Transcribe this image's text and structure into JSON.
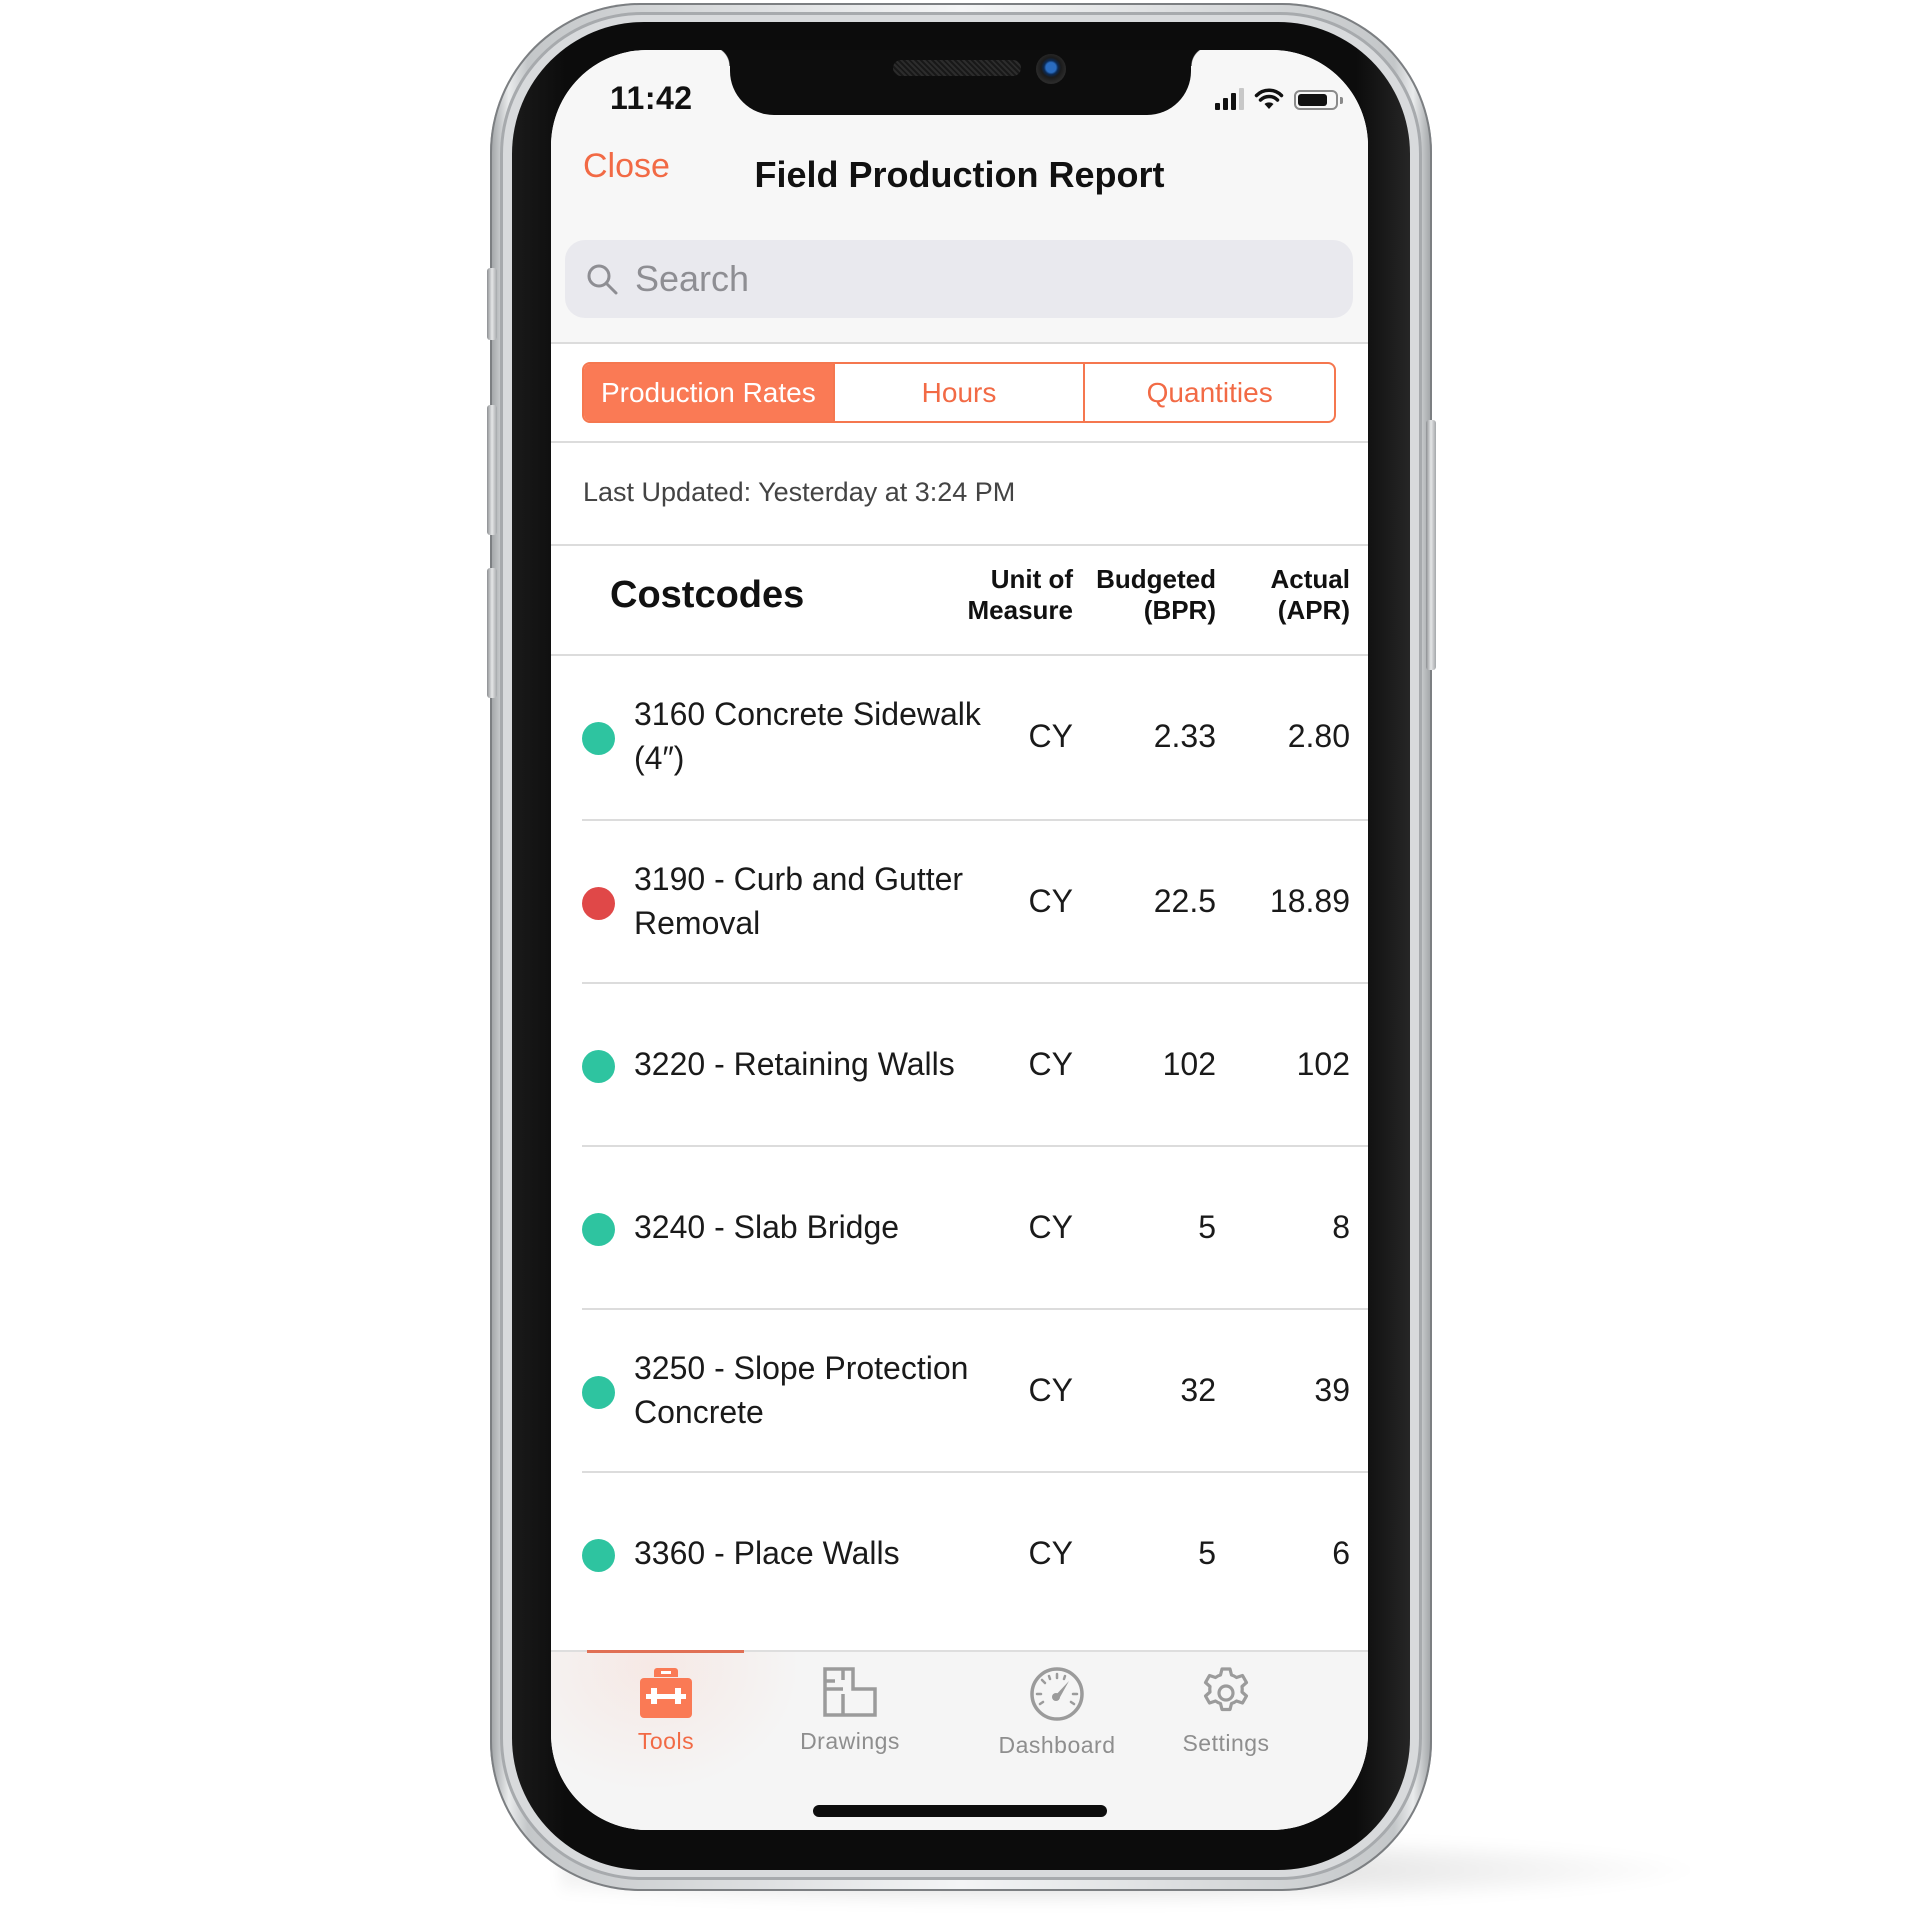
{
  "status_bar": {
    "time": "11:42",
    "signal_bars_filled": 3,
    "signal_bars_total": 4,
    "battery_level": 0.8
  },
  "nav": {
    "close_label": "Close",
    "title": "Field Production Report"
  },
  "search": {
    "placeholder": "Search",
    "value": ""
  },
  "segments": [
    {
      "label": "Production Rates",
      "active": true
    },
    {
      "label": "Hours",
      "active": false
    },
    {
      "label": "Quantities",
      "active": false
    }
  ],
  "last_updated": "Last Updated: Yesterday at 3:24 PM",
  "table": {
    "title": "Costcodes",
    "columns": {
      "unit_line1": "Unit of",
      "unit_line2": "Measure",
      "budgeted_line1": "Budgeted",
      "budgeted_line2": "(BPR)",
      "actual_line1": "Actual",
      "actual_line2": "(APR)"
    },
    "rows": [
      {
        "name": "3160 Concrete Sidewalk (4″)",
        "unit": "CY",
        "budgeted": "2.33",
        "actual": "2.80",
        "status": "good"
      },
      {
        "name": "3190 - Curb and Gutter Removal",
        "unit": "CY",
        "budgeted": "22.5",
        "actual": "18.89",
        "status": "bad"
      },
      {
        "name": "3220 - Retaining Walls",
        "unit": "CY",
        "budgeted": "102",
        "actual": "102",
        "status": "good"
      },
      {
        "name": "3240 - Slab Bridge",
        "unit": "CY",
        "budgeted": "5",
        "actual": "8",
        "status": "good"
      },
      {
        "name": "3250 - Slope Protection Concrete",
        "unit": "CY",
        "budgeted": "32",
        "actual": "39",
        "status": "good"
      },
      {
        "name": "3360 - Place Walls",
        "unit": "CY",
        "budgeted": "5",
        "actual": "6",
        "status": "good"
      }
    ]
  },
  "status_colors": {
    "good": "#2ec4a0",
    "bad": "#e04848"
  },
  "accent_color": "#fa7a55",
  "tabbar": {
    "items": [
      {
        "label": "Tools",
        "icon": "toolbox-icon",
        "active": true
      },
      {
        "label": "Drawings",
        "icon": "floorplan-icon",
        "active": false
      },
      {
        "label": "Dashboard",
        "icon": "speedometer-icon",
        "active": false
      },
      {
        "label": "Settings",
        "icon": "gear-icon",
        "active": false
      }
    ]
  }
}
